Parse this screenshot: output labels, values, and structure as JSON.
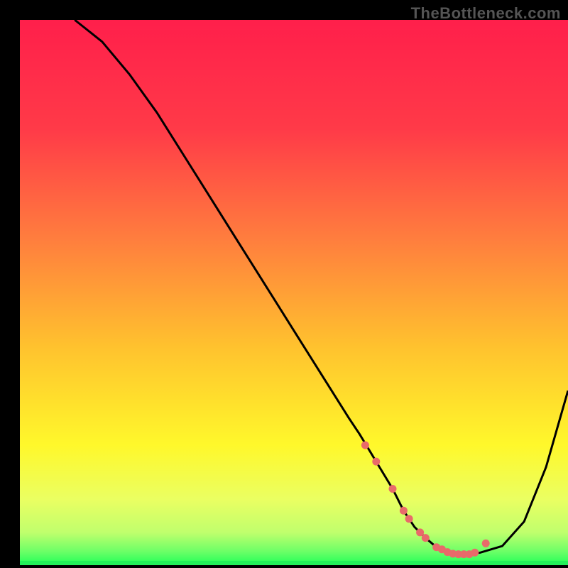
{
  "watermark": "TheBottleneck.com",
  "colors": {
    "background": "#000000",
    "curve_stroke": "#000000",
    "marker_fill": "#e96a6a",
    "green_band": "#24f05a",
    "pale_band": "#e9ff7d"
  },
  "chart_data": {
    "type": "line",
    "title": "",
    "xlabel": "",
    "ylabel": "",
    "xlim": [
      0,
      100
    ],
    "ylim": [
      0,
      100
    ],
    "gradient_stops": [
      {
        "offset": 0.0,
        "color": "#ff1f4b"
      },
      {
        "offset": 0.2,
        "color": "#ff3a48"
      },
      {
        "offset": 0.4,
        "color": "#ff7d3e"
      },
      {
        "offset": 0.6,
        "color": "#ffc22e"
      },
      {
        "offset": 0.78,
        "color": "#fff82b"
      },
      {
        "offset": 0.88,
        "color": "#eaff62"
      },
      {
        "offset": 0.94,
        "color": "#c0ff6d"
      },
      {
        "offset": 0.975,
        "color": "#6cff67"
      },
      {
        "offset": 1.0,
        "color": "#1fff58"
      }
    ],
    "series": [
      {
        "name": "bottleneck-curve",
        "x": [
          10,
          15,
          20,
          25,
          30,
          35,
          40,
          45,
          50,
          55,
          60,
          62,
          65,
          68,
          70,
          72,
          74,
          76,
          78,
          80,
          82,
          84,
          88,
          92,
          96,
          100
        ],
        "y": [
          100,
          96,
          90,
          83,
          75,
          67,
          59,
          51,
          43,
          35,
          27,
          24,
          19,
          14,
          10,
          7,
          5,
          3.3,
          2.4,
          2,
          2,
          2.3,
          3.5,
          8,
          18,
          32
        ]
      }
    ],
    "markers": {
      "name": "optimal-range",
      "x": [
        63,
        65,
        68,
        70,
        71,
        73,
        74,
        76,
        77,
        78,
        79,
        80,
        81,
        82,
        83,
        85
      ],
      "y": [
        22,
        19,
        14,
        10,
        8.5,
        6,
        5,
        3.3,
        2.9,
        2.4,
        2.1,
        2,
        2,
        2,
        2.3,
        4
      ]
    }
  }
}
